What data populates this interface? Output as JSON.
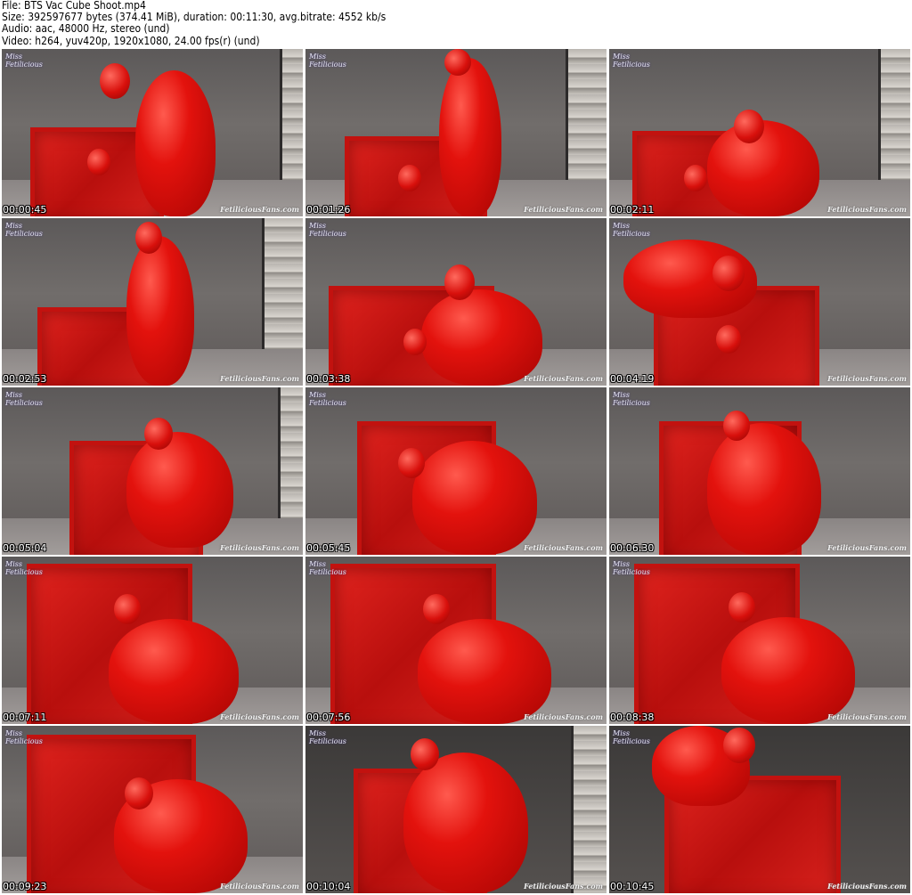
{
  "header": {
    "line1": "File: BTS Vac Cube Shoot.mp4",
    "line2": "Size: 392597677 bytes (374.41 MiB), duration: 00:11:30, avg.bitrate: 4552 kb/s",
    "line3": "Audio: aac, 48000 Hz, stereo (und)",
    "line4": "Video: h264, yuv420p, 1920x1080, 24.00 fps(r) (und)"
  },
  "logo_text": "Miss Fetilicious",
  "watermark_text": "FetiliciousFans.com",
  "thumbnails": [
    {
      "timestamp": "00:00:45"
    },
    {
      "timestamp": "00:01:26"
    },
    {
      "timestamp": "00:02:11"
    },
    {
      "timestamp": "00:02:53"
    },
    {
      "timestamp": "00:03:38"
    },
    {
      "timestamp": "00:04:19"
    },
    {
      "timestamp": "00:05:04"
    },
    {
      "timestamp": "00:05:45"
    },
    {
      "timestamp": "00:06:30"
    },
    {
      "timestamp": "00:07:11"
    },
    {
      "timestamp": "00:07:56"
    },
    {
      "timestamp": "00:08:38"
    },
    {
      "timestamp": "00:09:23"
    },
    {
      "timestamp": "00:10:04"
    },
    {
      "timestamp": "00:10:45"
    }
  ],
  "colors": {
    "latex_red": "#e3120d",
    "backdrop_gray": "#6a6665",
    "timestamp_text": "#ffffff"
  }
}
